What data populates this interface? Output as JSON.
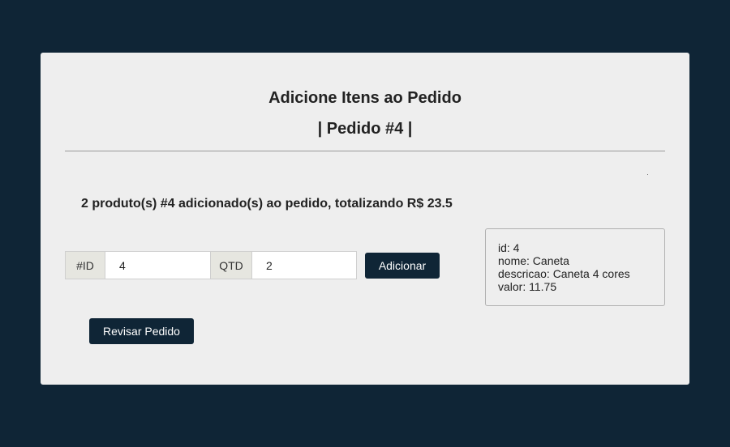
{
  "header": {
    "title": "Adicione Itens ao Pedido",
    "subtitle": "| Pedido #4 |"
  },
  "message": "2 produto(s) #4 adicionado(s) ao pedido, totalizando R$ 23.5",
  "form": {
    "id_label": "#ID",
    "id_value": "4",
    "qtd_label": "QTD",
    "qtd_value": "2",
    "add_button": "Adicionar"
  },
  "product_info": {
    "id": "id: 4",
    "nome": "nome: Caneta",
    "descricao": "descricao: Caneta 4 cores",
    "valor": "valor: 11.75"
  },
  "review_button": "Revisar Pedido",
  "colors": {
    "background": "#0f2536",
    "card": "#eeeeee",
    "button": "#0f2536"
  }
}
